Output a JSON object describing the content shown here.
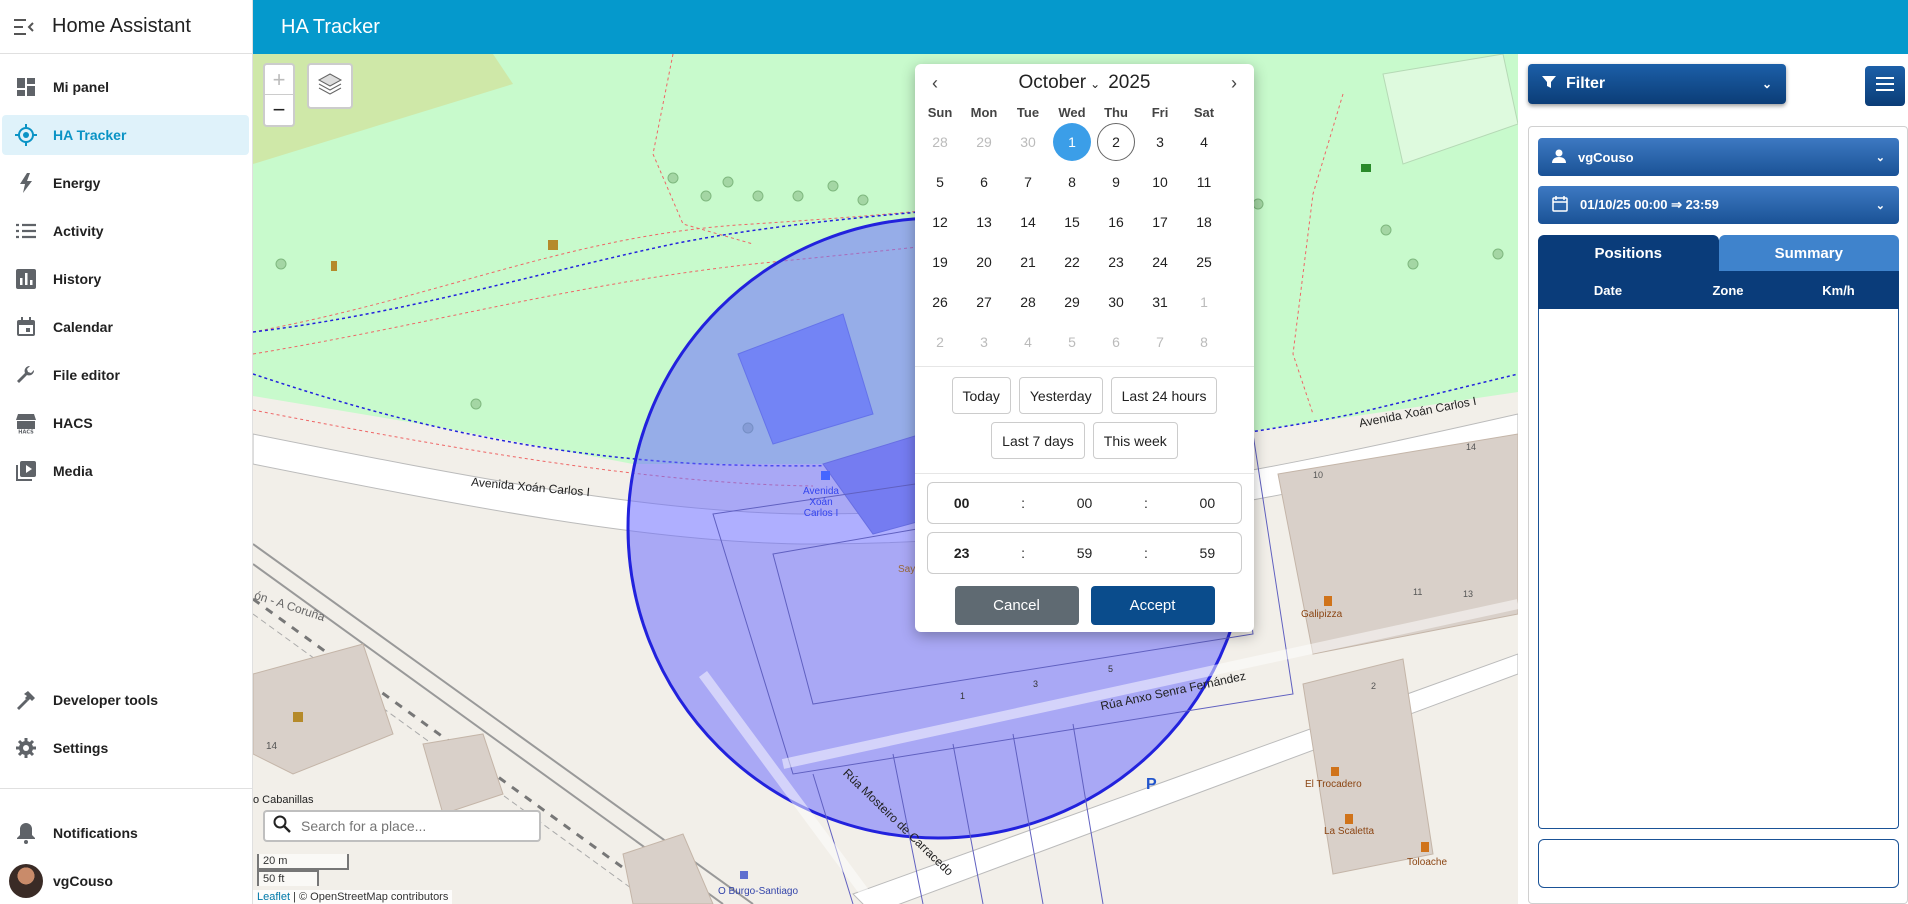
{
  "app": {
    "title": "Home Assistant",
    "page_title": "HA Tracker"
  },
  "sidebar": {
    "items": [
      {
        "label": "Mi panel",
        "icon": "dashboard-icon"
      },
      {
        "label": "HA Tracker",
        "icon": "crosshair-icon",
        "active": true
      },
      {
        "label": "Energy",
        "icon": "lightning-icon"
      },
      {
        "label": "Activity",
        "icon": "list-icon"
      },
      {
        "label": "History",
        "icon": "chart-bar-icon"
      },
      {
        "label": "Calendar",
        "icon": "calendar-icon"
      },
      {
        "label": "File editor",
        "icon": "wrench-icon"
      },
      {
        "label": "HACS",
        "icon": "hacs-icon"
      },
      {
        "label": "Media",
        "icon": "play-box-icon"
      }
    ],
    "bottom": {
      "developer_tools": "Developer tools",
      "settings": "Settings",
      "notifications": "Notifications",
      "user": "vgCouso"
    }
  },
  "map": {
    "zoom_in": "+",
    "zoom_out": "−",
    "search_placeholder": "Search for a place...",
    "scale_metric": "20 m",
    "scale_imperial": "50 ft",
    "attribution_leaflet": "Leaflet",
    "attribution_rest": " | © OpenStreetMap contributors",
    "labels": {
      "street1": "Avenida Xoán Carlos I",
      "street2": "Avenida Xoán Carlos I",
      "bus_stop": "Avenida Xoán Carlos I",
      "coruna": "ón - A Coruña",
      "cabanillas": "o Cabanillas",
      "anxo": "Rúa Anxo Senra Fernández",
      "mosteiro": "Rúa Mosteiro de Carracedo",
      "galipizza": "Galipizza",
      "trocadero": "El Trocadero",
      "scaletta": "La Scaletta",
      "toloache": "Toloache",
      "burgo": "O Burgo-Santiago",
      "parking": "P",
      "num14": "14",
      "num10": "10",
      "num11": "11",
      "num13": "13",
      "num14b": "14",
      "num2": "2",
      "num5": "5",
      "num3": "3",
      "num1": "1",
      "sa": "Say"
    },
    "colors": {
      "park": "#c8facc",
      "geofence": "#2222dd",
      "geofence_fill": "rgba(110,110,255,0.55)"
    }
  },
  "datepicker": {
    "month": "October",
    "year": "2025",
    "weekdays": [
      "Sun",
      "Mon",
      "Tue",
      "Wed",
      "Thu",
      "Fri",
      "Sat"
    ],
    "days": [
      [
        "28",
        "m"
      ],
      [
        "29",
        "m"
      ],
      [
        "30",
        "m"
      ],
      [
        "1",
        "sel"
      ],
      [
        "2",
        "today"
      ],
      [
        "3",
        ""
      ],
      [
        "4",
        ""
      ],
      [
        "5",
        ""
      ],
      [
        "6",
        ""
      ],
      [
        "7",
        ""
      ],
      [
        "8",
        ""
      ],
      [
        "9",
        ""
      ],
      [
        "10",
        ""
      ],
      [
        "11",
        ""
      ],
      [
        "12",
        ""
      ],
      [
        "13",
        ""
      ],
      [
        "14",
        ""
      ],
      [
        "15",
        ""
      ],
      [
        "16",
        ""
      ],
      [
        "17",
        ""
      ],
      [
        "18",
        ""
      ],
      [
        "19",
        ""
      ],
      [
        "20",
        ""
      ],
      [
        "21",
        ""
      ],
      [
        "22",
        ""
      ],
      [
        "23",
        ""
      ],
      [
        "24",
        ""
      ],
      [
        "25",
        ""
      ],
      [
        "26",
        ""
      ],
      [
        "27",
        ""
      ],
      [
        "28",
        ""
      ],
      [
        "29",
        ""
      ],
      [
        "30",
        ""
      ],
      [
        "31",
        ""
      ],
      [
        "1",
        "m"
      ],
      [
        "2",
        "m"
      ],
      [
        "3",
        "m"
      ],
      [
        "4",
        "m"
      ],
      [
        "5",
        "m"
      ],
      [
        "6",
        "m"
      ],
      [
        "7",
        "m"
      ],
      [
        "8",
        "m"
      ]
    ],
    "presets": [
      "Today",
      "Yesterday",
      "Last 24 hours",
      "Last 7 days",
      "This week"
    ],
    "start_time": {
      "h": "00",
      "m": "00",
      "s": "00"
    },
    "end_time": {
      "h": "23",
      "m": "59",
      "s": "59"
    },
    "separator": ":",
    "cancel": "Cancel",
    "accept": "Accept",
    "colors": {
      "selected": "#3b9ee8",
      "accept": "#0a4c8c",
      "cancel": "#5f6a72"
    }
  },
  "panel": {
    "filter_label": "Filter",
    "person": "vgCouso",
    "date_range": "01/10/25 00:00 ⇒ 23:59",
    "tabs": [
      "Positions",
      "Summary"
    ],
    "columns": [
      "Date",
      "Zone",
      "Km/h"
    ],
    "colors": {
      "header": "#0a3c7a",
      "tab_off": "#3f83cc"
    }
  }
}
